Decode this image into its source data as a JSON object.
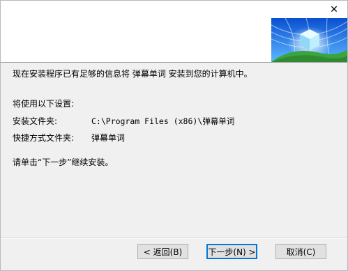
{
  "header": {
    "close_glyph": "✕"
  },
  "body": {
    "intro": "现在安装程序已有足够的信息将 弹幕单词 安装到您的计算机中。",
    "settings_heading": "将使用以下设置:",
    "install_folder_label": "安装文件夹:",
    "install_folder_value": "C:\\Program Files (x86)\\弹幕单词",
    "shortcut_folder_label": "快捷方式文件夹:",
    "shortcut_folder_value": "弹幕单词",
    "instruction": "请单击“下一步”继续安装。"
  },
  "buttons": {
    "back": "< 返回(B)",
    "next": "下一步(N) >",
    "cancel": "取消(C)"
  },
  "colors": {
    "accent": "#0078d7",
    "banner_blue": "#1e90ff",
    "banner_green": "#4caf50"
  }
}
